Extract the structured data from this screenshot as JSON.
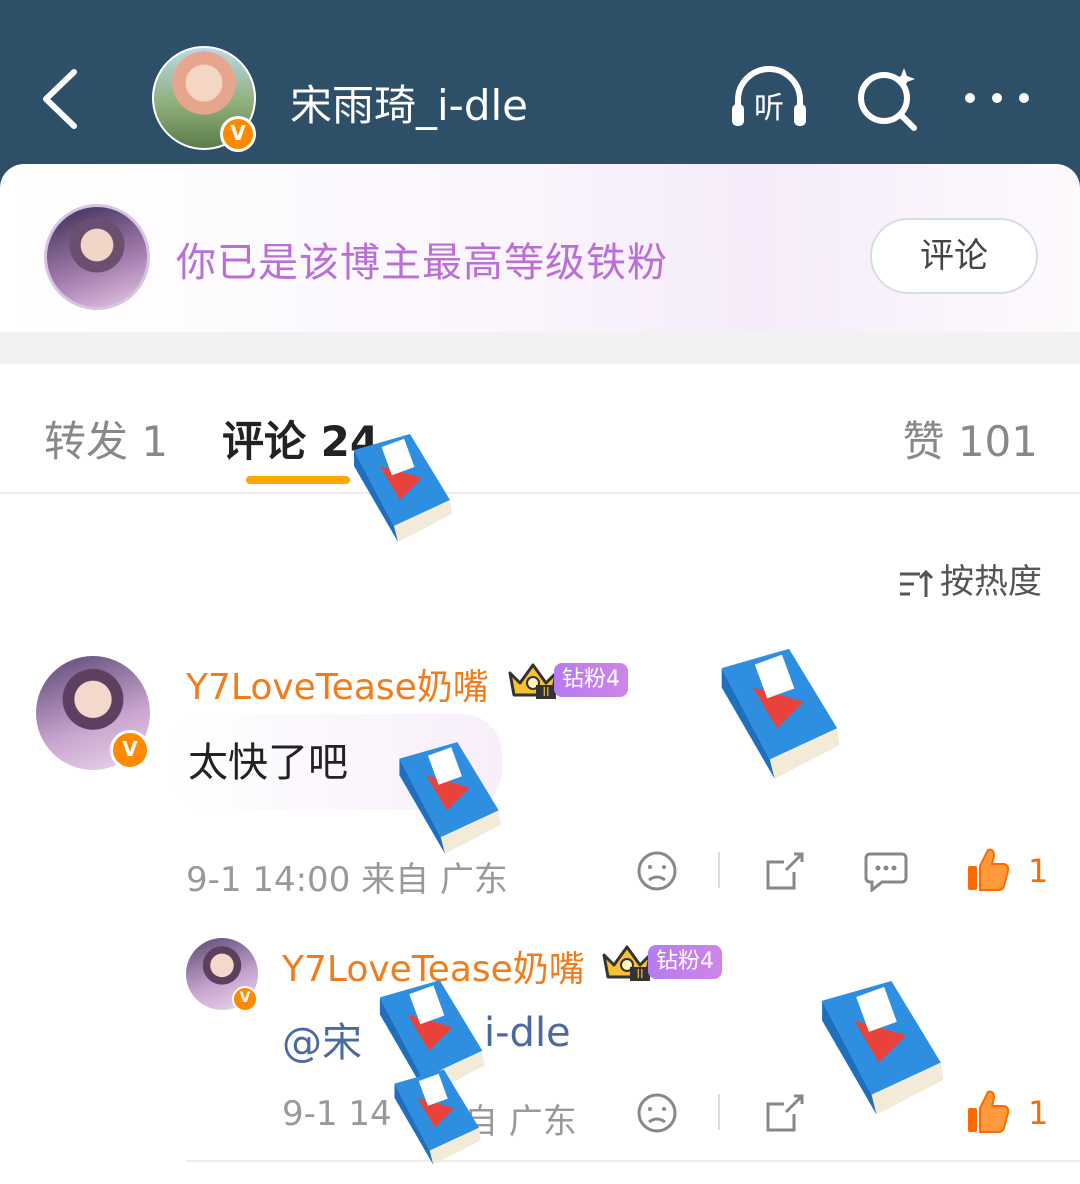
{
  "header": {
    "user_name": "宋雨琦_i-dle",
    "verified_badge": "V",
    "icons": [
      "back-icon",
      "listen-icon",
      "search-icon",
      "more-icon"
    ],
    "listen_label": "听"
  },
  "fan_banner": {
    "text": "你已是该博主最高等级铁粉",
    "button_label": "评论"
  },
  "tabs": {
    "forward": "转发 1",
    "comment": "评论 24",
    "like": "赞 101"
  },
  "sort": {
    "label": "按热度"
  },
  "comments": [
    {
      "user": "Y7LoveTease奶嘴",
      "verified_badge": "V",
      "fan_level": "钻粉4",
      "crown_numeral": "II",
      "text": "太快了吧",
      "time_location": "9-1 14:00  来自 广东",
      "likes": "1"
    },
    {
      "user": "Y7LoveTease奶嘴",
      "verified_badge": "V",
      "fan_level": "钻粉4",
      "crown_numeral": "II",
      "text_mention": "@宋",
      "text_suffix": "i-dle",
      "time_prefix": "9-1 14",
      "location": "自 广东",
      "likes": "1"
    }
  ],
  "colors": {
    "header_bg": "#2e4f68",
    "accent_orange": "#ffa600",
    "username_orange": "#f07c1c",
    "fan_purple": "#b96fd6",
    "like_orange": "#ff6a00"
  }
}
